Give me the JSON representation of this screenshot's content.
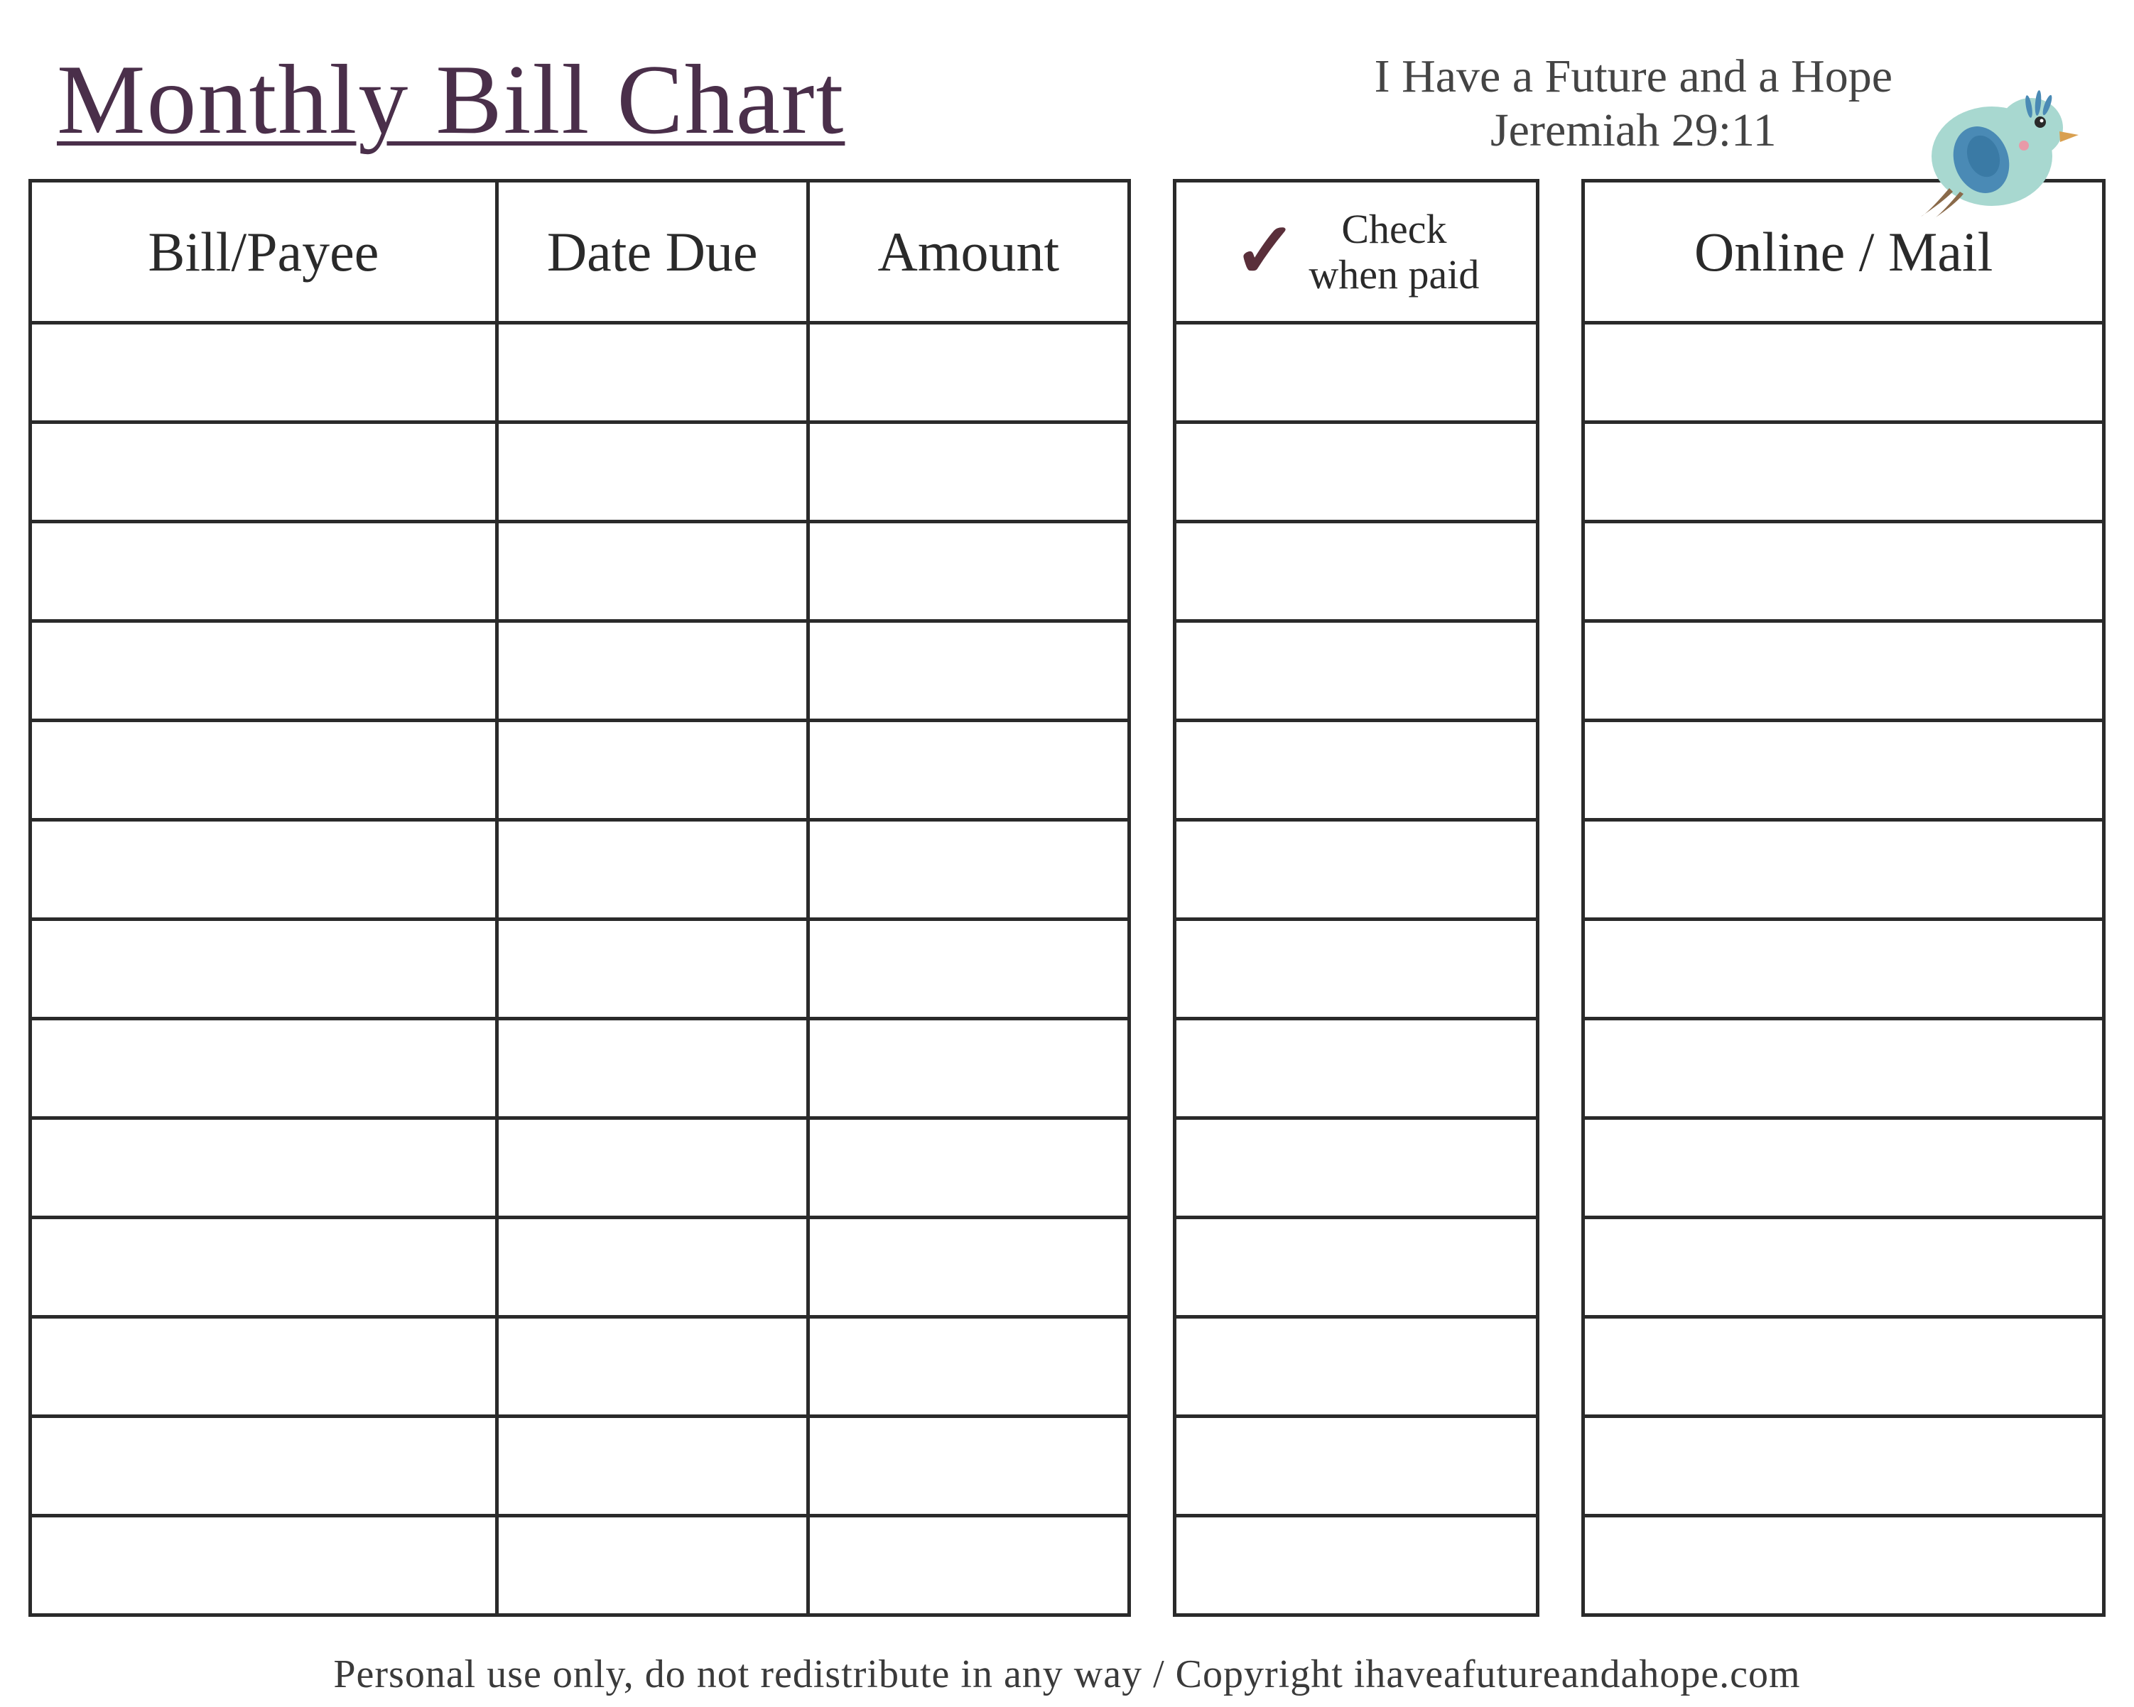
{
  "header": {
    "title": "Monthly Bill Chart",
    "quote_line1": "I Have a Future and a Hope",
    "quote_line2": "Jeremiah 29:11"
  },
  "columns": {
    "bill_payee": "Bill/Payee",
    "date_due": "Date Due",
    "amount": "Amount",
    "check_when_paid_line1": "Check",
    "check_when_paid_line2": "when paid",
    "online_mail": "Online / Mail"
  },
  "row_count": 13,
  "chart_data": {
    "type": "table",
    "title": "Monthly Bill Chart",
    "columns": [
      "Bill/Payee",
      "Date Due",
      "Amount",
      "Check when paid",
      "Online / Mail"
    ],
    "rows": [
      [
        "",
        "",
        "",
        "",
        ""
      ],
      [
        "",
        "",
        "",
        "",
        ""
      ],
      [
        "",
        "",
        "",
        "",
        ""
      ],
      [
        "",
        "",
        "",
        "",
        ""
      ],
      [
        "",
        "",
        "",
        "",
        ""
      ],
      [
        "",
        "",
        "",
        "",
        ""
      ],
      [
        "",
        "",
        "",
        "",
        ""
      ],
      [
        "",
        "",
        "",
        "",
        ""
      ],
      [
        "",
        "",
        "",
        "",
        ""
      ],
      [
        "",
        "",
        "",
        "",
        ""
      ],
      [
        "",
        "",
        "",
        "",
        ""
      ],
      [
        "",
        "",
        "",
        "",
        ""
      ],
      [
        "",
        "",
        "",
        "",
        ""
      ]
    ]
  },
  "footer": "Personal use only, do not redistribute in any way / Copyright ihaveafutureandahope.com"
}
